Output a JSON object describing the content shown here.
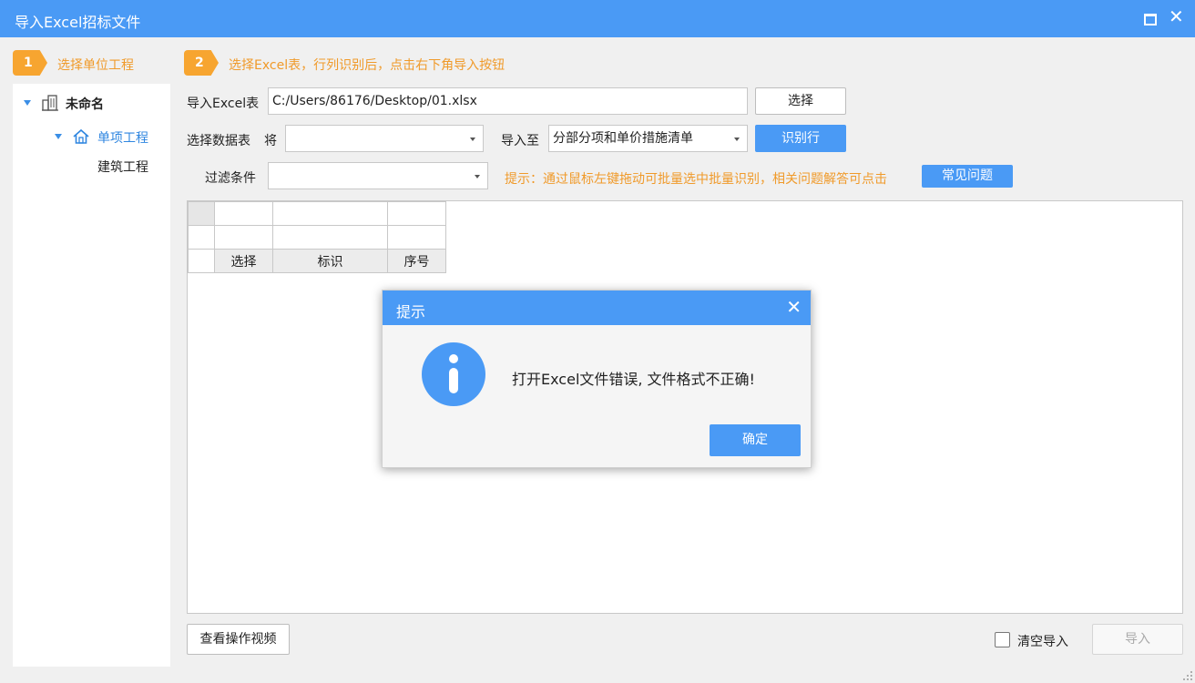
{
  "window": {
    "title": "导入Excel招标文件"
  },
  "steps": [
    {
      "number": "1",
      "label": "选择单位工程"
    },
    {
      "number": "2",
      "label": "选择Excel表，行列识别后，点击右下角导入按钮"
    }
  ],
  "tree": {
    "root": "未命名",
    "child": "单项工程",
    "leaf": "建筑工程"
  },
  "form": {
    "excel_label": "导入Excel表",
    "excel_path": "C:/Users/86176/Desktop/01.xlsx",
    "choose_button": "选择",
    "sheet_label": "选择数据表",
    "sheet_prefix": "将",
    "sheet_value": "",
    "import_to_label": "导入至",
    "import_to_value": "分部分项和单价措施清单",
    "identify_button": "识别行",
    "filter_label": "过滤条件",
    "filter_value": "",
    "hint": "提示：通过鼠标左键拖动可批量选中批量识别，相关问题解答可点击",
    "faq_button": "常见问题"
  },
  "grid": {
    "headers": [
      "选择",
      "标识",
      "序号"
    ]
  },
  "dialog": {
    "title": "提示",
    "message": "打开Excel文件错误, 文件格式不正确!",
    "ok_label": "确定"
  },
  "footer": {
    "video_button": "查看操作视频",
    "clear_import_label": "清空导入",
    "import_button": "导入"
  },
  "colors": {
    "accent": "#4a9af5",
    "step_orange": "#f7a530",
    "hint_orange": "#f09a2a"
  },
  "icons": [
    "maximize-icon",
    "close-icon",
    "building-icon",
    "home-icon",
    "info-icon",
    "chevron-down-icon"
  ]
}
